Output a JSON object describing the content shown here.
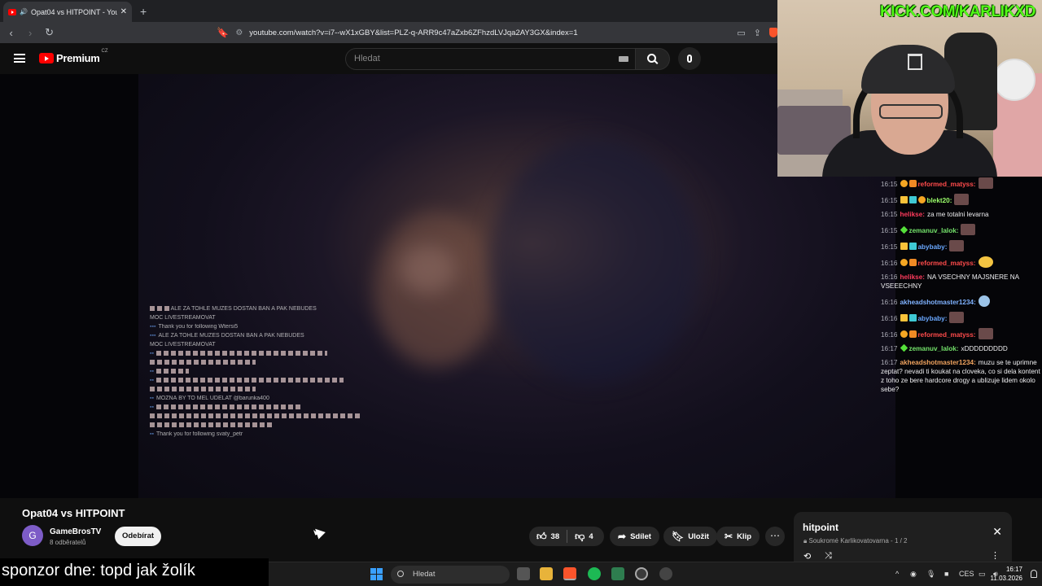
{
  "browser": {
    "tab_title": "Opat04 vs HITPOINT - YouTub",
    "new_tab_icon": "+",
    "url": "youtube.com/watch?v=i7--wX1xGBY&list=PLZ-q-ARR9c47aZxb6ZFhzdLVJqa2AY3GX&index=1"
  },
  "youtube": {
    "logo_text": "Premium",
    "country_code": "CZ",
    "search_placeholder": "Hledat"
  },
  "webcam": {
    "overlay_text": "KICK.COM/KARLIKXD"
  },
  "video_overlay_chat": [
    {
      "user": "",
      "text": "ALE ZA TOHLE MŮŽEŠ DOSTAN BAN A PAK NEBUDEŠ"
    },
    {
      "user": "",
      "text": "MOC LIVESTREAMOVAT"
    },
    {
      "user": "",
      "text": "Thank you for following Wtersi5"
    },
    {
      "user": "",
      "text": "ALE ZA TOHLE MŮŽEŠ DOSTAN BAN A PAK NEBUDEŠ"
    },
    {
      "user": "",
      "text": "MOC LIVESTREAMOVAT"
    },
    {
      "user": "",
      "text": "MOŽNÁ BY TO MĚL UDĚLAT @barunka400"
    },
    {
      "user": "",
      "text": "Thank you for following svaty_petr"
    }
  ],
  "stream_chat": [
    {
      "time": "16:15",
      "user": "reformed_matyss:",
      "user_color": "#ff4b4b",
      "text": "",
      "badges": [
        "coin",
        "gift"
      ],
      "emote": "sq"
    },
    {
      "time": "16:15",
      "user": "blekt20:",
      "user_color": "#9bff6a",
      "text": "",
      "badges": [
        "crown",
        "grid",
        "coin"
      ],
      "emote": "sq"
    },
    {
      "time": "16:15",
      "user": "helikse:",
      "user_color": "#ff3b5c",
      "text": "za me totalni levarna",
      "badges": [],
      "emote": ""
    },
    {
      "time": "16:15",
      "user": "zemanuv_lalok:",
      "user_color": "#74e36b",
      "text": "",
      "badges": [
        "star"
      ],
      "emote": "sq"
    },
    {
      "time": "16:15",
      "user": "abybaby:",
      "user_color": "#6aa8ff",
      "text": "",
      "badges": [
        "crown",
        "grid"
      ],
      "emote": "sq"
    },
    {
      "time": "16:16",
      "user": "reformed_matyss:",
      "user_color": "#ff4b4b",
      "text": "",
      "badges": [
        "coin",
        "gift"
      ],
      "emote": "yel"
    },
    {
      "time": "16:16",
      "user": "helikse:",
      "user_color": "#ff3b5c",
      "text": "NA VSECHNY MAJSNERE NA VSEEECHNY",
      "badges": [],
      "emote": ""
    },
    {
      "time": "16:16",
      "user": "akheadshotmaster1234:",
      "user_color": "#7fb2ff",
      "text": "",
      "badges": [],
      "emote": "blu"
    },
    {
      "time": "16:16",
      "user": "abybaby:",
      "user_color": "#6aa8ff",
      "text": "",
      "badges": [
        "crown",
        "grid"
      ],
      "emote": "sq"
    },
    {
      "time": "16:16",
      "user": "reformed_matyss:",
      "user_color": "#ff4b4b",
      "text": "",
      "badges": [
        "coin",
        "gift"
      ],
      "emote": "sq"
    },
    {
      "time": "16:17",
      "user": "zemanuv_lalok:",
      "user_color": "#74e36b",
      "text": "xDDDDDDDDD",
      "badges": [
        "star"
      ],
      "emote": ""
    },
    {
      "time": "16:17",
      "user": "akheadshotmaster1234:",
      "user_color": "#f0a35e",
      "text": "muzu se te uprimne zeptat? nevadi ti koukat na cloveka, co si dela kontent z toho ze bere hardcore drogy a ublizuje lidem okolo sebe?",
      "badges": [],
      "emote": ""
    }
  ],
  "video": {
    "title": "Opat04 vs HITPOINT",
    "channel_initial": "G",
    "channel_name": "GameBrosTV",
    "subscribers": "8 odběratelů",
    "subscribe_label": "Odebírat",
    "likes": "38",
    "dislikes": "4",
    "share_label": "Sdílet",
    "save_label": "Uložit",
    "clip_label": "Klip"
  },
  "playlist": {
    "title": "hitpoint",
    "privacy": "Soukromé",
    "owner": "Karlikovatovarna",
    "position": "1 / 2"
  },
  "sponsor_text": "sponzor dne: topd jak žolík",
  "taskbar": {
    "search_label": "Hledat",
    "language": "CES",
    "time": "16:17",
    "date": "11.03.2026"
  }
}
